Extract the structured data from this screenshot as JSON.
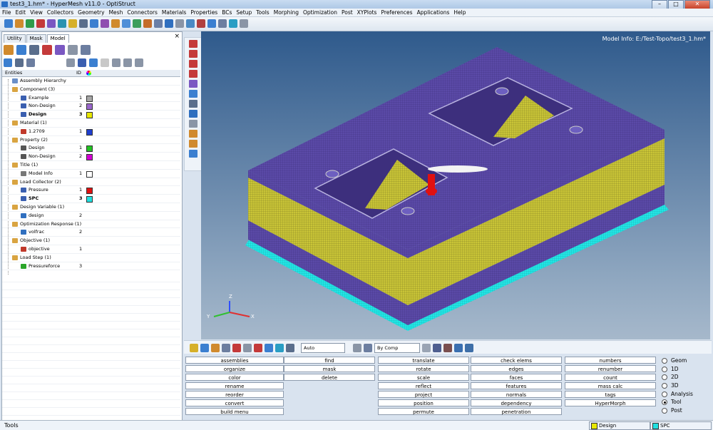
{
  "window": {
    "title": "test3_1.hm* - HyperMesh v11.0 - OptiStruct",
    "min": "–",
    "max": "□",
    "close": "✕"
  },
  "menu": [
    "File",
    "Edit",
    "View",
    "Collectors",
    "Geometry",
    "Mesh",
    "Connectors",
    "Materials",
    "Properties",
    "BCs",
    "Setup",
    "Tools",
    "Morphing",
    "Optimization",
    "Post",
    "XYPlots",
    "Preferences",
    "Applications",
    "Help"
  ],
  "tabs": [
    "Utility",
    "Mask",
    "Model"
  ],
  "pane_close": "×",
  "entities_header": {
    "entities": "Entities",
    "id": "ID"
  },
  "tree": [
    {
      "label": "Assembly Hierarchy",
      "level": 0,
      "id": "",
      "color": "",
      "bold": false,
      "icon": "#6a8fc8"
    },
    {
      "label": "Component (3)",
      "level": 0,
      "id": "",
      "color": "",
      "bold": false,
      "icon": "#d9a441"
    },
    {
      "label": "Example",
      "level": 1,
      "id": "1",
      "color": "#a6a6a6",
      "bold": false,
      "icon": "#3a5fb0"
    },
    {
      "label": "Non-Design",
      "level": 1,
      "id": "2",
      "color": "#9966cc",
      "bold": false,
      "icon": "#3a5fb0"
    },
    {
      "label": "Design",
      "level": 1,
      "id": "3",
      "color": "#e8e800",
      "bold": true,
      "icon": "#3a5fb0"
    },
    {
      "label": "Material (1)",
      "level": 0,
      "id": "",
      "color": "",
      "bold": false,
      "icon": "#d9a441"
    },
    {
      "label": "1.2709",
      "level": 1,
      "id": "1",
      "color": "#1f3fcf",
      "bold": false,
      "icon": "#c0392b"
    },
    {
      "label": "Property (2)",
      "level": 0,
      "id": "",
      "color": "",
      "bold": false,
      "icon": "#d9a441"
    },
    {
      "label": "Design",
      "level": 1,
      "id": "1",
      "color": "#22c322",
      "bold": false,
      "icon": "#555555"
    },
    {
      "label": "Non-Design",
      "level": 1,
      "id": "2",
      "color": "#d400d4",
      "bold": false,
      "icon": "#555555"
    },
    {
      "label": "Title (1)",
      "level": 0,
      "id": "",
      "color": "",
      "bold": false,
      "icon": "#d9a441"
    },
    {
      "label": "Model Info",
      "level": 1,
      "id": "1",
      "color": "#ffffff",
      "bold": false,
      "icon": "#777777"
    },
    {
      "label": "Load Collector (2)",
      "level": 0,
      "id": "",
      "color": "",
      "bold": false,
      "icon": "#d9a441"
    },
    {
      "label": "Pressure",
      "level": 1,
      "id": "1",
      "color": "#e01010",
      "bold": false,
      "icon": "#3a5fb0"
    },
    {
      "label": "SPC",
      "level": 1,
      "id": "3",
      "color": "#20e0e0",
      "bold": true,
      "icon": "#3a5fb0"
    },
    {
      "label": "Design Variable (1)",
      "level": 0,
      "id": "",
      "color": "",
      "bold": false,
      "icon": "#d9a441"
    },
    {
      "label": "design",
      "level": 1,
      "id": "2",
      "color": "",
      "bold": false,
      "icon": "#2f6fbf"
    },
    {
      "label": "Optimization Response (1)",
      "level": 0,
      "id": "",
      "color": "",
      "bold": false,
      "icon": "#d9a441"
    },
    {
      "label": "volfrac",
      "level": 1,
      "id": "2",
      "color": "",
      "bold": false,
      "icon": "#2f6fbf"
    },
    {
      "label": "Objective (1)",
      "level": 0,
      "id": "",
      "color": "",
      "bold": false,
      "icon": "#d9a441"
    },
    {
      "label": "objective",
      "level": 1,
      "id": "1",
      "color": "",
      "bold": false,
      "icon": "#c0392b"
    },
    {
      "label": "Load Step (1)",
      "level": 0,
      "id": "",
      "color": "",
      "bold": false,
      "icon": "#d9a441"
    },
    {
      "label": "Pressureforce",
      "level": 1,
      "id": "3",
      "color": "",
      "bold": false,
      "icon": "#2aa52a"
    }
  ],
  "viewport": {
    "model_info": "Model Info: E:/Test-Topo/test3_1.hm*",
    "axis": {
      "x": "X",
      "y": "Y",
      "z": "Z"
    }
  },
  "bottom_toolbar": {
    "auto_label": "Auto",
    "bycomp_label": "By Comp"
  },
  "panel": {
    "columns": [
      [
        "assemblies",
        "organize",
        "color",
        "rename",
        "reorder",
        "convert",
        "build menu"
      ],
      [
        "find",
        "mask",
        "delete"
      ],
      [
        "translate",
        "rotate",
        "scale",
        "reflect",
        "project",
        "position",
        "permute"
      ],
      [
        "check elems",
        "edges",
        "faces",
        "features",
        "normals",
        "dependency",
        "penetration"
      ],
      [
        "numbers",
        "renumber",
        "count",
        "mass calc",
        "tags",
        "HyperMorph"
      ]
    ],
    "radios": [
      {
        "label": "Geom",
        "checked": false
      },
      {
        "label": "1D",
        "checked": false
      },
      {
        "label": "2D",
        "checked": false
      },
      {
        "label": "3D",
        "checked": false
      },
      {
        "label": "Analysis",
        "checked": false
      },
      {
        "label": "Tool",
        "checked": true
      },
      {
        "label": "Post",
        "checked": false
      }
    ]
  },
  "status": {
    "left": "Tools",
    "comp": "Design",
    "comp_color": "#e8e800",
    "lc": "SPC",
    "lc_color": "#20e0e0"
  },
  "colors": {
    "mesh_purple": "#5b4aa8",
    "mesh_yellow": "#c9c437",
    "spc_cyan": "#22e6e6",
    "pressure_red": "#e01010"
  }
}
